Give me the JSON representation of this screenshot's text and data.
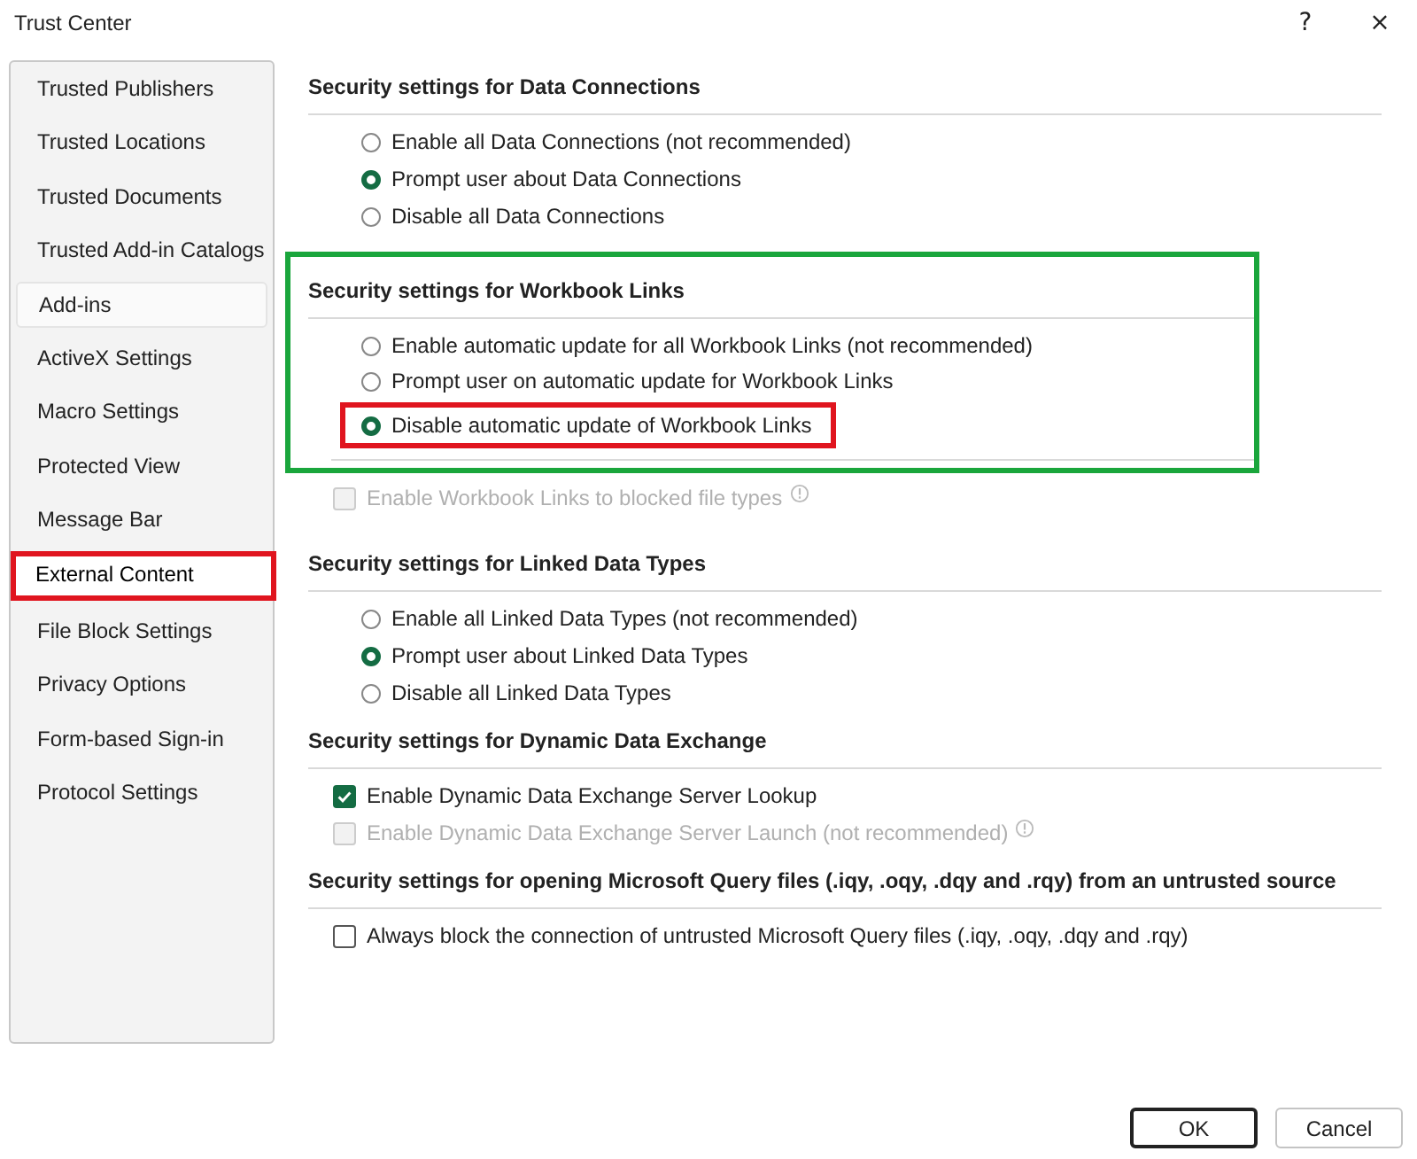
{
  "window": {
    "title": "Trust Center",
    "help": "?",
    "close": "×"
  },
  "sidebar": {
    "items": [
      {
        "label": "Trusted Publishers",
        "selected": false,
        "hovered": false,
        "highlighted": false
      },
      {
        "label": "Trusted Locations",
        "selected": false,
        "hovered": false,
        "highlighted": false
      },
      {
        "label": "Trusted Documents",
        "selected": false,
        "hovered": false,
        "highlighted": false
      },
      {
        "label": "Trusted Add-in Catalogs",
        "selected": false,
        "hovered": false,
        "highlighted": false
      },
      {
        "label": "Add-ins",
        "selected": false,
        "hovered": true,
        "highlighted": false
      },
      {
        "label": "ActiveX Settings",
        "selected": false,
        "hovered": false,
        "highlighted": false
      },
      {
        "label": "Macro Settings",
        "selected": false,
        "hovered": false,
        "highlighted": false
      },
      {
        "label": "Protected View",
        "selected": false,
        "hovered": false,
        "highlighted": false
      },
      {
        "label": "Message Bar",
        "selected": false,
        "hovered": false,
        "highlighted": false
      },
      {
        "label": "External Content",
        "selected": true,
        "hovered": false,
        "highlighted": true
      },
      {
        "label": "File Block Settings",
        "selected": false,
        "hovered": false,
        "highlighted": false
      },
      {
        "label": "Privacy Options",
        "selected": false,
        "hovered": false,
        "highlighted": false
      },
      {
        "label": "Form-based Sign-in",
        "selected": false,
        "hovered": false,
        "highlighted": false
      },
      {
        "label": "Protocol Settings",
        "selected": false,
        "hovered": false,
        "highlighted": false
      }
    ]
  },
  "sections": [
    {
      "heading": "Security settings for Data Connections",
      "highlighted": false,
      "options": [
        {
          "kind": "radio",
          "label": "Enable all Data Connections (not recommended)",
          "selected": false,
          "highlighted": false
        },
        {
          "kind": "radio",
          "label": "Prompt user about Data Connections",
          "selected": true,
          "highlighted": false
        },
        {
          "kind": "radio",
          "label": "Disable all Data Connections",
          "selected": false,
          "highlighted": false
        }
      ]
    },
    {
      "heading": "Security settings for Workbook Links",
      "highlighted": true,
      "options": [
        {
          "kind": "radio",
          "label": "Enable automatic update for all Workbook Links (not recommended)",
          "selected": false,
          "highlighted": false
        },
        {
          "kind": "radio",
          "label": "Prompt user on automatic update for Workbook Links",
          "selected": false,
          "highlighted": false
        },
        {
          "kind": "radio",
          "label": "Disable automatic update of Workbook Links",
          "selected": true,
          "highlighted": true
        }
      ],
      "trailing": [
        {
          "kind": "checkbox",
          "label": "Enable Workbook Links to blocked file types",
          "checked": false,
          "disabled": true,
          "info": true
        }
      ]
    },
    {
      "heading": "Security settings for Linked Data Types",
      "highlighted": false,
      "options": [
        {
          "kind": "radio",
          "label": "Enable all Linked Data Types (not recommended)",
          "selected": false,
          "highlighted": false
        },
        {
          "kind": "radio",
          "label": "Prompt user about Linked Data Types",
          "selected": true,
          "highlighted": false
        },
        {
          "kind": "radio",
          "label": "Disable all Linked Data Types",
          "selected": false,
          "highlighted": false
        }
      ]
    },
    {
      "heading": "Security settings for Dynamic Data Exchange",
      "highlighted": false,
      "options": [
        {
          "kind": "checkbox",
          "label": "Enable Dynamic Data Exchange Server Lookup",
          "checked": true,
          "disabled": false,
          "info": false
        },
        {
          "kind": "checkbox",
          "label": "Enable Dynamic Data Exchange Server Launch (not recommended)",
          "checked": false,
          "disabled": true,
          "info": true
        }
      ]
    },
    {
      "heading": "Security settings for opening  Microsoft Query files (.iqy, .oqy, .dqy and .rqy) from an untrusted source",
      "highlighted": false,
      "options": [
        {
          "kind": "checkbox",
          "label": "Always block the connection of untrusted Microsoft Query files (.iqy, .oqy, .dqy and .rqy)",
          "checked": false,
          "disabled": false,
          "info": false
        }
      ]
    }
  ],
  "buttons": [
    {
      "label": "OK",
      "default": true
    },
    {
      "label": "Cancel",
      "default": false
    }
  ]
}
